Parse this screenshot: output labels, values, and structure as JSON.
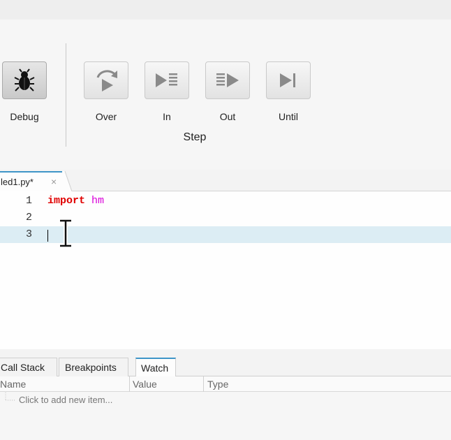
{
  "ribbon": {
    "debug_label": "Debug",
    "step_group_label": "Step",
    "buttons": [
      {
        "label": "Over",
        "icon": "step-over-icon"
      },
      {
        "label": "In",
        "icon": "step-in-icon"
      },
      {
        "label": "Out",
        "icon": "step-out-icon"
      },
      {
        "label": "Until",
        "icon": "step-until-icon"
      }
    ]
  },
  "editor": {
    "tab_label": "led1.py*",
    "tab_close": "×",
    "line_numbers": [
      "1",
      "2",
      "3"
    ],
    "line1_keyword": "import",
    "line1_module": "hm",
    "current_line": 3
  },
  "bottom_panel": {
    "tabs": [
      "Call Stack",
      "Breakpoints",
      "Watch"
    ],
    "active_tab": "Watch",
    "columns": [
      "Name",
      "Value",
      "Type"
    ],
    "placeholder_row": "Click to add new item..."
  },
  "colors": {
    "keyword": "#e00000",
    "module": "#d900d9",
    "current_line_bg": "#dcedf4",
    "active_tab_accent": "#3e95c8"
  }
}
